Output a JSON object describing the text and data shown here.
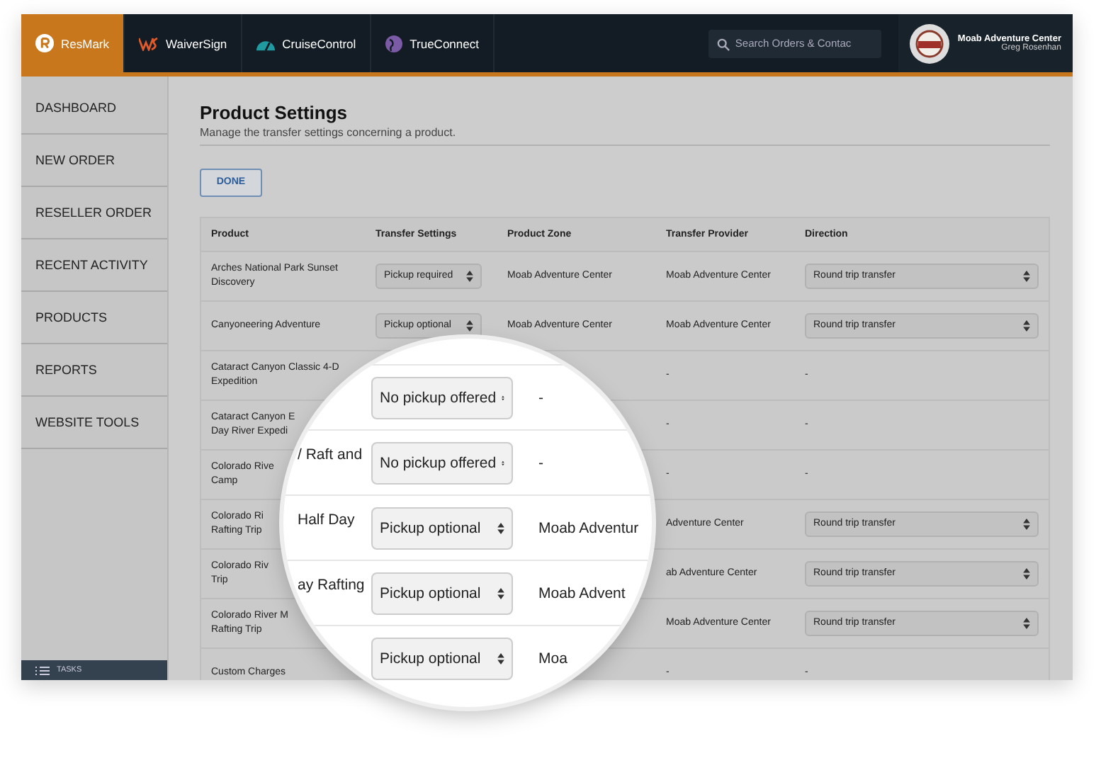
{
  "top_bar": {
    "apps": [
      {
        "label": "ResMark",
        "selected": true,
        "kind": "resmark"
      },
      {
        "label": "WaiverSign",
        "selected": false,
        "kind": "waiver"
      },
      {
        "label": "CruiseControl",
        "selected": false,
        "kind": "cruise"
      },
      {
        "label": "TrueConnect",
        "selected": false,
        "kind": "connect"
      }
    ],
    "search": {
      "placeholder": "Search Orders & Contac"
    },
    "account": {
      "name": "Moab Adventure Center",
      "user": "Greg Rosenhan"
    }
  },
  "sidebar": {
    "items": [
      "DASHBOARD",
      "NEW ORDER",
      "RESELLER ORDER",
      "RECENT ACTIVITY",
      "PRODUCTS",
      "REPORTS",
      "WEBSITE TOOLS"
    ],
    "footer": "TASKS"
  },
  "page": {
    "title": "Product Settings",
    "subtitle": "Manage the transfer settings concerning a product.",
    "done_button": "DONE"
  },
  "table": {
    "columns": [
      "Product",
      "Transfer Settings",
      "Product Zone",
      "Transfer Provider",
      "Direction"
    ],
    "rows": [
      {
        "product": [
          "Arches National Park Sunset",
          "Discovery"
        ],
        "transfer_setting": "Pickup required",
        "zone": "Moab Adventure Center",
        "provider": "Moab Adventure Center",
        "direction": {
          "kind": "select",
          "value": "Round trip transfer"
        }
      },
      {
        "product": [
          "Canyoneering Adventure"
        ],
        "transfer_setting": "Pickup optional",
        "zone": "Moab Adventure Center",
        "provider": "Moab Adventure Center",
        "direction": {
          "kind": "select",
          "value": "Round trip transfer"
        }
      },
      {
        "product": [
          "Cataract Canyon Classic 4-D",
          "Expedition"
        ],
        "provider": "-",
        "direction": {
          "kind": "text",
          "value": "-"
        }
      },
      {
        "product": [
          "Cataract Canyon E",
          "Day River Expedi"
        ],
        "provider": "-",
        "direction": {
          "kind": "text",
          "value": "-"
        }
      },
      {
        "product": [
          "Colorado Rive",
          "Camp"
        ],
        "provider": "-",
        "direction": {
          "kind": "text",
          "value": "-"
        }
      },
      {
        "product": [
          "Colorado Ri",
          "Rafting Trip"
        ],
        "provider": "Adventure Center",
        "direction": {
          "kind": "select",
          "value": "Round trip transfer"
        }
      },
      {
        "product": [
          "Colorado Riv",
          "Trip"
        ],
        "provider": "ab Adventure Center",
        "direction": {
          "kind": "select",
          "value": "Round trip transfer"
        }
      },
      {
        "product": [
          "Colorado River M",
          "Rafting Trip"
        ],
        "provider": "Moab Adventure Center",
        "direction": {
          "kind": "select",
          "value": "Round trip transfer"
        }
      },
      {
        "product": [
          "Custom Charges"
        ],
        "provider": "-",
        "direction": {
          "kind": "text",
          "value": "-"
        }
      }
    ]
  },
  "magnifier": {
    "rows": [
      {
        "transfer_setting": "No pickup offered",
        "zone": "-"
      },
      {
        "product": "/ Raft and",
        "transfer_setting": "No pickup offered",
        "zone": "-"
      },
      {
        "product": "Half Day",
        "transfer_setting": "Pickup optional",
        "zone": "Moab Adventur"
      },
      {
        "product": "ay Rafting",
        "transfer_setting": "Pickup optional",
        "zone": "Moab Advent"
      },
      {
        "transfer_setting": "Pickup optional",
        "zone": "Moa"
      }
    ]
  }
}
